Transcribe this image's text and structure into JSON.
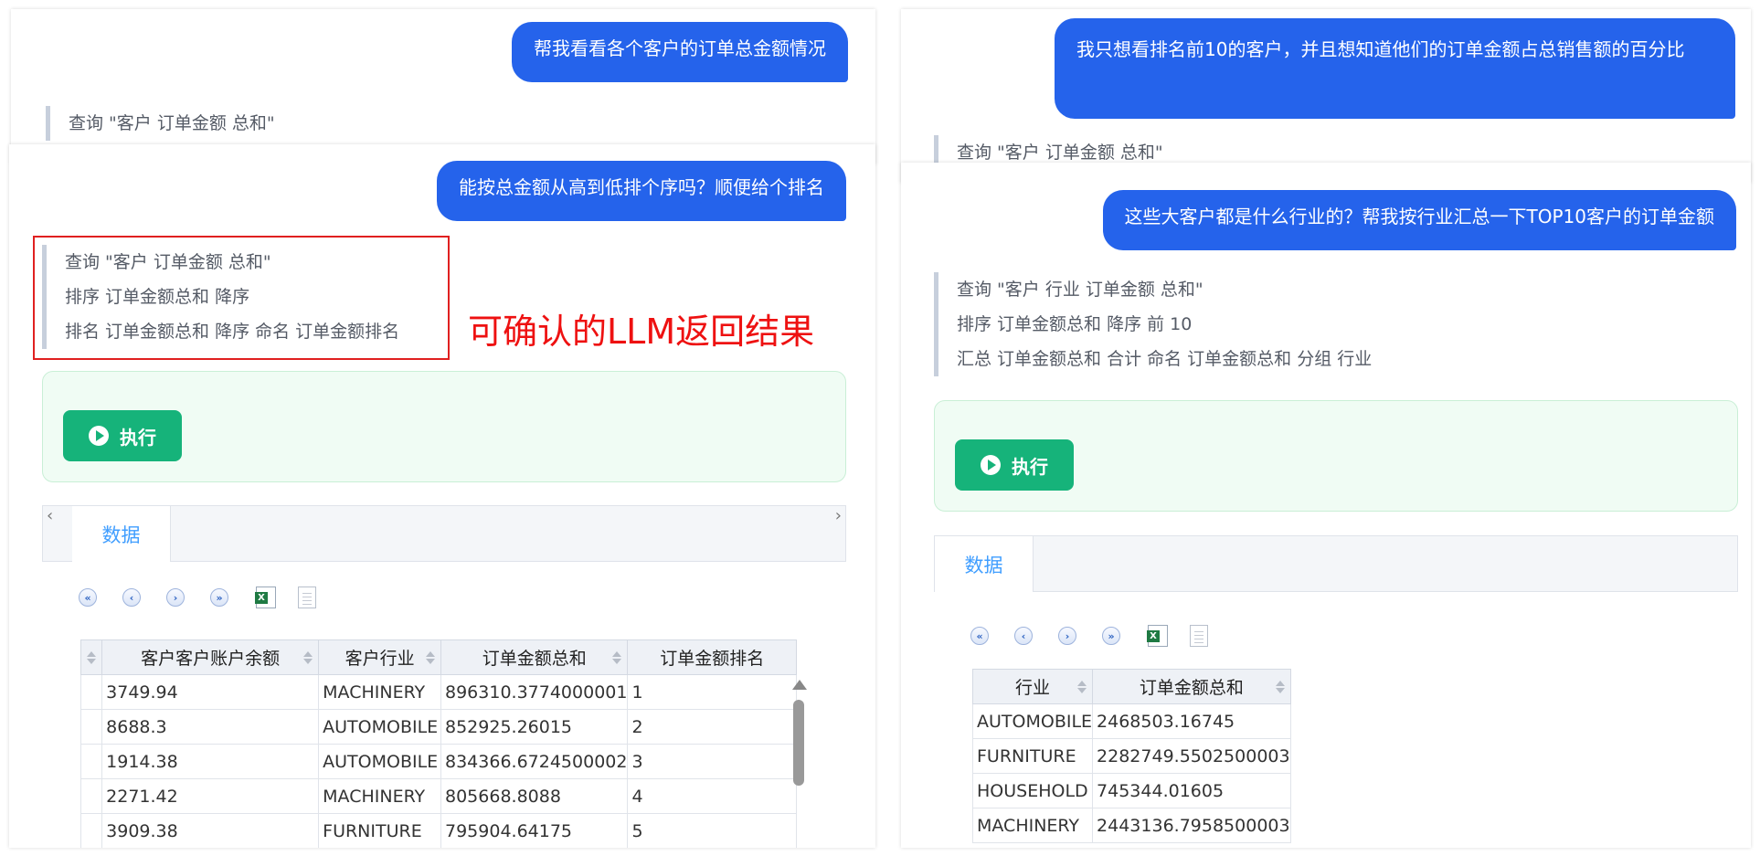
{
  "left": {
    "top_message": "帮我看看各个客户的订单总金额情况",
    "top_query": "查询 \"客户 订单金额 总和\"",
    "message": "能按总金额从高到低排个序吗？顺便给个排名",
    "result_lines": [
      "查询 \"客户 订单金额 总和\"",
      "排序 订单金额总和 降序",
      "排名 订单金额总和 降序 命名 订单金额排名"
    ],
    "annotation": "可确认的LLM返回结果",
    "execute_label": "执行",
    "tab_label": "数据",
    "columns": [
      "客户客户账户余额",
      "客户行业",
      "订单金额总和",
      "订单金额排名"
    ],
    "rows": [
      [
        "3749.94",
        "MACHINERY",
        "896310.3774000001",
        "1"
      ],
      [
        "8688.3",
        "AUTOMOBILE",
        "852925.26015",
        "2"
      ],
      [
        "1914.38",
        "AUTOMOBILE",
        "834366.6724500002",
        "3"
      ],
      [
        "2271.42",
        "MACHINERY",
        "805668.8088",
        "4"
      ],
      [
        "3909.38",
        "FURNITURE",
        "795904.64175",
        "5"
      ]
    ]
  },
  "right": {
    "top_message": "我只想看排名前10的客户，并且想知道他们的订单金额占总销售额的百分比",
    "top_query": "查询 \"客户 订单金额 总和\"",
    "message": "这些大客户都是什么行业的？帮我按行业汇总一下TOP10客户的订单金额",
    "result_lines": [
      "查询 \"客户 行业 订单金额 总和\"",
      "排序 订单金额总和 降序 前 10",
      "汇总 订单金额总和 合计 命名 订单金额总和 分组 行业"
    ],
    "execute_label": "执行",
    "tab_label": "数据",
    "columns": [
      "行业",
      "订单金额总和"
    ],
    "rows": [
      [
        "AUTOMOBILE",
        "2468503.16745"
      ],
      [
        "FURNITURE",
        "2282749.5502500003"
      ],
      [
        "HOUSEHOLD",
        "745344.01605"
      ],
      [
        "MACHINERY",
        "2443136.7958500003"
      ]
    ]
  },
  "colors": {
    "bubble": "#2563eb",
    "execute_button": "#16b37a",
    "tab_active": "#409eff",
    "annotation": "#ee1111"
  }
}
